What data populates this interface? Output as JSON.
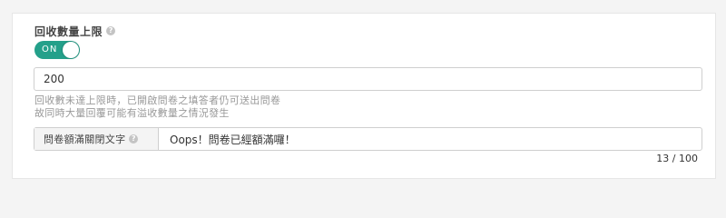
{
  "field": {
    "title": "回收數量上限",
    "toggle_label": "ON",
    "limit_value": "200",
    "hint_line1": "回收數未達上限時，已開啟問卷之填答者仍可送出問卷",
    "hint_line2": "故同時大量回覆可能有溢收數量之情況發生"
  },
  "closed_text": {
    "label": "問卷額滿關閉文字",
    "value": "Oops！問卷已經額滿囉！",
    "counter": "13 / 100"
  },
  "icons": {
    "help": "help-icon"
  },
  "colors": {
    "toggle_on": "#24a08a",
    "background": "#f4f4f4",
    "hint_text": "#999999"
  }
}
